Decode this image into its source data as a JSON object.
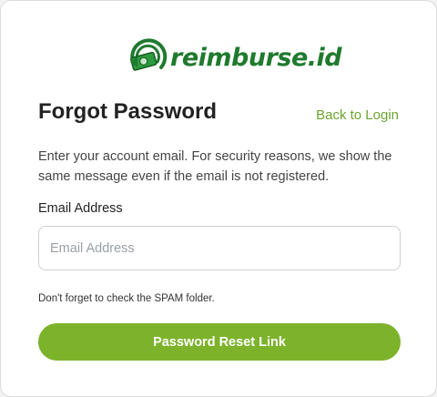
{
  "brand": {
    "logo_text": "reimburse.id",
    "logo_icon": "money-bill-swirl-icon",
    "brand_color": "#1f7a2e"
  },
  "form": {
    "title": "Forgot Password",
    "back_link": "Back to Login",
    "description": "Enter your account email. For security reasons, we show the same message even if the email is not registered.",
    "email_label": "Email Address",
    "email_placeholder": "Email Address",
    "email_value": "",
    "hint": "Don't forget to check the SPAM folder.",
    "submit_label": "Password Reset Link"
  },
  "colors": {
    "accent": "#7cb32b",
    "link": "#6aa52e"
  }
}
